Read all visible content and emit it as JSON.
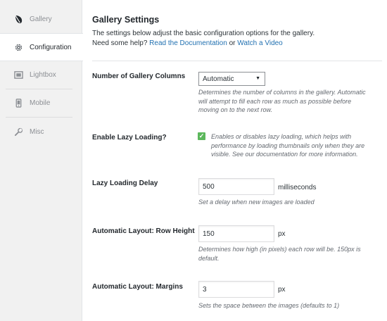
{
  "sidebar": {
    "items": [
      {
        "label": "Gallery",
        "icon": "leaf-icon"
      },
      {
        "label": "Configuration",
        "icon": "gear-icon"
      },
      {
        "label": "Lightbox",
        "icon": "image-icon"
      },
      {
        "label": "Mobile",
        "icon": "smartphone-icon"
      },
      {
        "label": "Misc",
        "icon": "wrench-icon"
      }
    ],
    "active": "Configuration"
  },
  "header": {
    "title": "Gallery Settings",
    "intro": "The settings below adjust the basic configuration options for the gallery.",
    "help_prefix": "Need some help?",
    "doc_link": "Read the Documentation",
    "or": "or",
    "video_link": "Watch a Video"
  },
  "settings": {
    "columns": {
      "label": "Number of Gallery Columns",
      "value": "Automatic",
      "desc": "Determines the number of columns in the gallery. Automatic will attempt to fill each row as much as possible before moving on to the next row."
    },
    "lazy": {
      "label": "Enable Lazy Loading?",
      "checked": true,
      "desc": "Enables or disables lazy loading, which helps with performance by loading thumbnails only when they are visible. See our documentation for more information."
    },
    "lazy_delay": {
      "label": "Lazy Loading Delay",
      "value": "500",
      "unit": "milliseconds",
      "desc": "Set a delay when new images are loaded"
    },
    "row_height": {
      "label": "Automatic Layout: Row Height",
      "value": "150",
      "unit": "px",
      "desc": "Determines how high (in pixels) each row will be. 150px is default."
    },
    "margins": {
      "label": "Automatic Layout: Margins",
      "value": "3",
      "unit": "px",
      "desc": "Sets the space between the images (defaults to 1)"
    }
  },
  "colors": {
    "link": "#2271b1",
    "check": "#5cb85c",
    "text": "#23282d",
    "muted": "#646970"
  }
}
